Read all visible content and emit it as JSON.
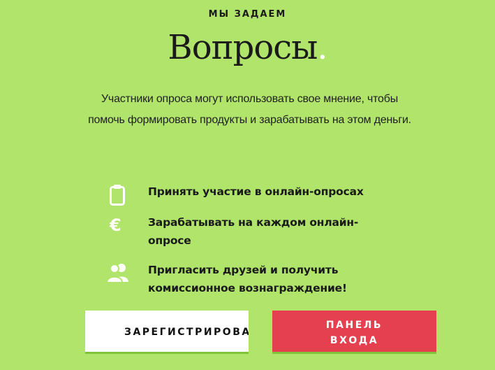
{
  "header": {
    "eyebrow": "МЫ ЗАДАЕМ",
    "title": "Вопросы",
    "title_dot": "."
  },
  "intro": {
    "text": "Участники опроса могут использовать свое мнение, чтобы помочь формировать продукты и зарабатывать на этом деньги."
  },
  "features": [
    {
      "icon": "clipboard-icon",
      "text": "Принять участие в онлайн-опросах"
    },
    {
      "icon": "euro-icon",
      "text": "Зарабатывать на каждом онлайн-опросе"
    },
    {
      "icon": "users-icon",
      "text": "Пригласить друзей и получить комиссионное вознаграждение!"
    }
  ],
  "buttons": {
    "register_label": "ЗАРЕГИСТРИРОВАТЬСЯ",
    "login_label": "ПАНЕЛЬ\nВХОДА"
  },
  "colors": {
    "background": "#b0e46a",
    "login_button": "#e4404f",
    "register_button": "#ffffff",
    "accent_underline": "#7fc33b"
  }
}
